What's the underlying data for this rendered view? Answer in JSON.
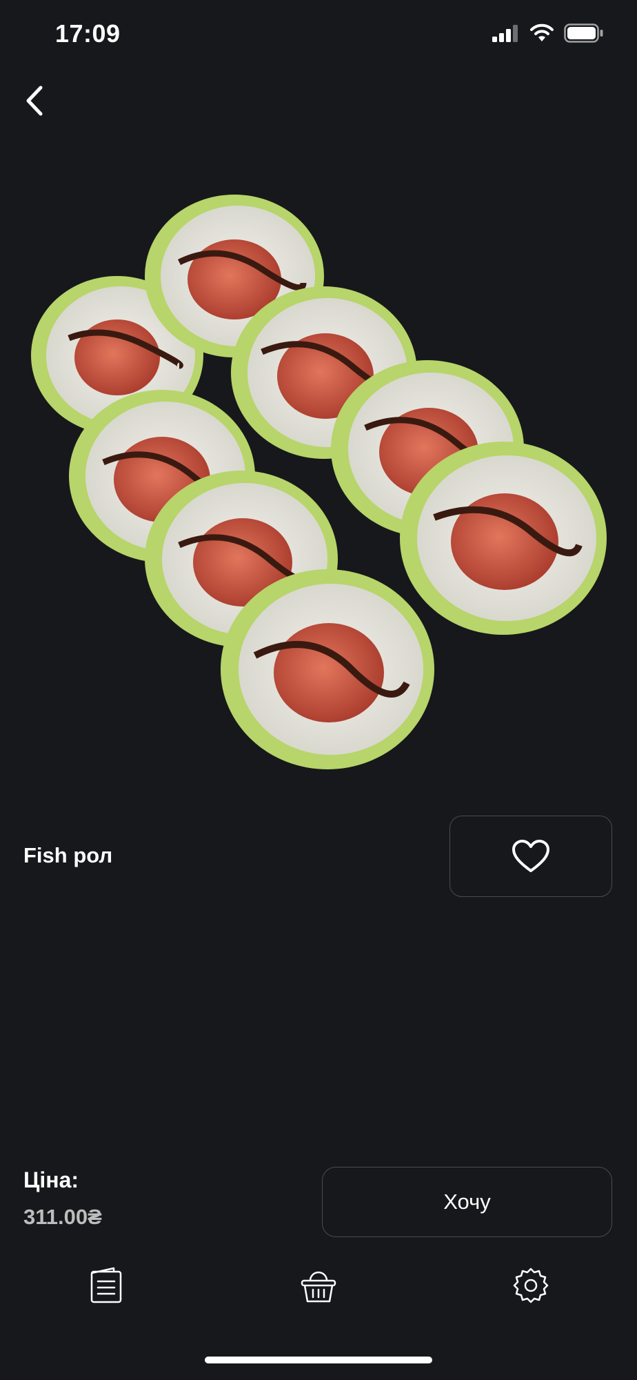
{
  "status_bar": {
    "time": "17:09",
    "signal_icon": "cellular-signal-icon",
    "wifi_icon": "wifi-icon",
    "battery_icon": "battery-icon"
  },
  "header": {
    "back_icon": "chevron-left-icon"
  },
  "product": {
    "name": "Fish рол",
    "image": "sushi-roll-image",
    "favorite_icon": "heart-icon"
  },
  "purchase": {
    "price_label": "Ціна:",
    "price_value": "311.00₴",
    "want_button_label": "Хочу"
  },
  "bottom_nav": {
    "items": [
      {
        "icon": "menu-document-icon"
      },
      {
        "icon": "basket-icon"
      },
      {
        "icon": "gear-icon"
      }
    ]
  },
  "colors": {
    "background": "#17181b",
    "border": "#4a4c52",
    "text": "#ffffff",
    "price": "#bdbdbd"
  }
}
